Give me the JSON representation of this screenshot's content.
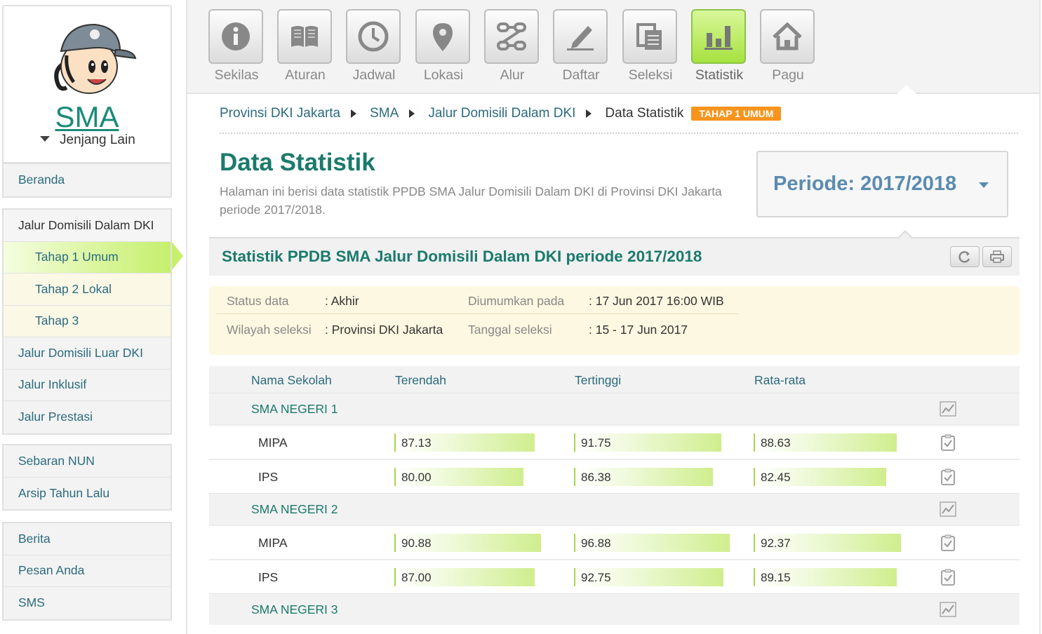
{
  "sidebar": {
    "jenjang": "SMA",
    "jenjang_lain": "Jenjang Lain",
    "group1": [
      {
        "label": "Beranda"
      }
    ],
    "group2": [
      {
        "label": "Jalur Domisili Dalam DKI"
      },
      {
        "label": "Tahap 1 Umum"
      },
      {
        "label": "Tahap 2 Lokal"
      },
      {
        "label": "Tahap 3"
      },
      {
        "label": "Jalur Domisili Luar DKI"
      },
      {
        "label": "Jalur Inklusif"
      },
      {
        "label": "Jalur Prestasi"
      }
    ],
    "group3": [
      {
        "label": "Sebaran NUN"
      },
      {
        "label": "Arsip Tahun Lalu"
      }
    ],
    "group4": [
      {
        "label": "Berita"
      },
      {
        "label": "Pesan Anda"
      },
      {
        "label": "SMS"
      }
    ]
  },
  "nav": [
    {
      "label": "Sekilas",
      "icon": "info-icon"
    },
    {
      "label": "Aturan",
      "icon": "book-icon"
    },
    {
      "label": "Jadwal",
      "icon": "clock-icon"
    },
    {
      "label": "Lokasi",
      "icon": "map-pin-icon"
    },
    {
      "label": "Alur",
      "icon": "flow-icon"
    },
    {
      "label": "Daftar",
      "icon": "pencil-icon"
    },
    {
      "label": "Seleksi",
      "icon": "clipboard-icon"
    },
    {
      "label": "Statistik",
      "icon": "bar-chart-icon",
      "active": true
    },
    {
      "label": "Pagu",
      "icon": "home-icon"
    }
  ],
  "breadcrumb": {
    "items": [
      "Provinsi DKI Jakarta",
      "SMA",
      "Jalur Domisili Dalam DKI",
      "Data Statistik"
    ],
    "badge": "TAHAP 1 UMUM"
  },
  "page": {
    "title": "Data Statistik",
    "description": "Halaman ini berisi data statistik PPDB SMA Jalur Domisili Dalam DKI di Provinsi DKI Jakarta periode 2017/2018.",
    "periode": "Periode: 2017/2018"
  },
  "stat": {
    "title": "Statistik PPDB SMA Jalur Domisili Dalam DKI periode 2017/2018"
  },
  "info": {
    "status_label": "Status data",
    "status_value": ": Akhir",
    "diumumkan_label": "Diumumkan pada",
    "diumumkan_value": ": 17 Jun 2017 16:00 WIB",
    "wilayah_label": "Wilayah seleksi",
    "wilayah_value": ": Provinsi DKI Jakarta",
    "tanggal_label": "Tanggal seleksi",
    "tanggal_value": ": 15 - 17 Jun 2017"
  },
  "table": {
    "headers": [
      "Nama Sekolah",
      "Terendah",
      "Tertinggi",
      "Rata-rata"
    ],
    "schools": [
      {
        "name": "SMA NEGERI 1",
        "programs": [
          {
            "name": "MIPA",
            "min": "87.13",
            "max": "91.75",
            "avg": "88.63"
          },
          {
            "name": "IPS",
            "min": "80.00",
            "max": "86.38",
            "avg": "82.45"
          }
        ]
      },
      {
        "name": "SMA NEGERI 2",
        "programs": [
          {
            "name": "MIPA",
            "min": "90.88",
            "max": "96.88",
            "avg": "92.37"
          },
          {
            "name": "IPS",
            "min": "87.00",
            "max": "92.75",
            "avg": "89.15"
          }
        ]
      },
      {
        "name": "SMA NEGERI 3",
        "programs": []
      }
    ]
  },
  "colors": {
    "accent": "#1a7a6c",
    "link": "#2b6b7e",
    "badge": "#f7941d",
    "active": "#c6ef6c"
  }
}
